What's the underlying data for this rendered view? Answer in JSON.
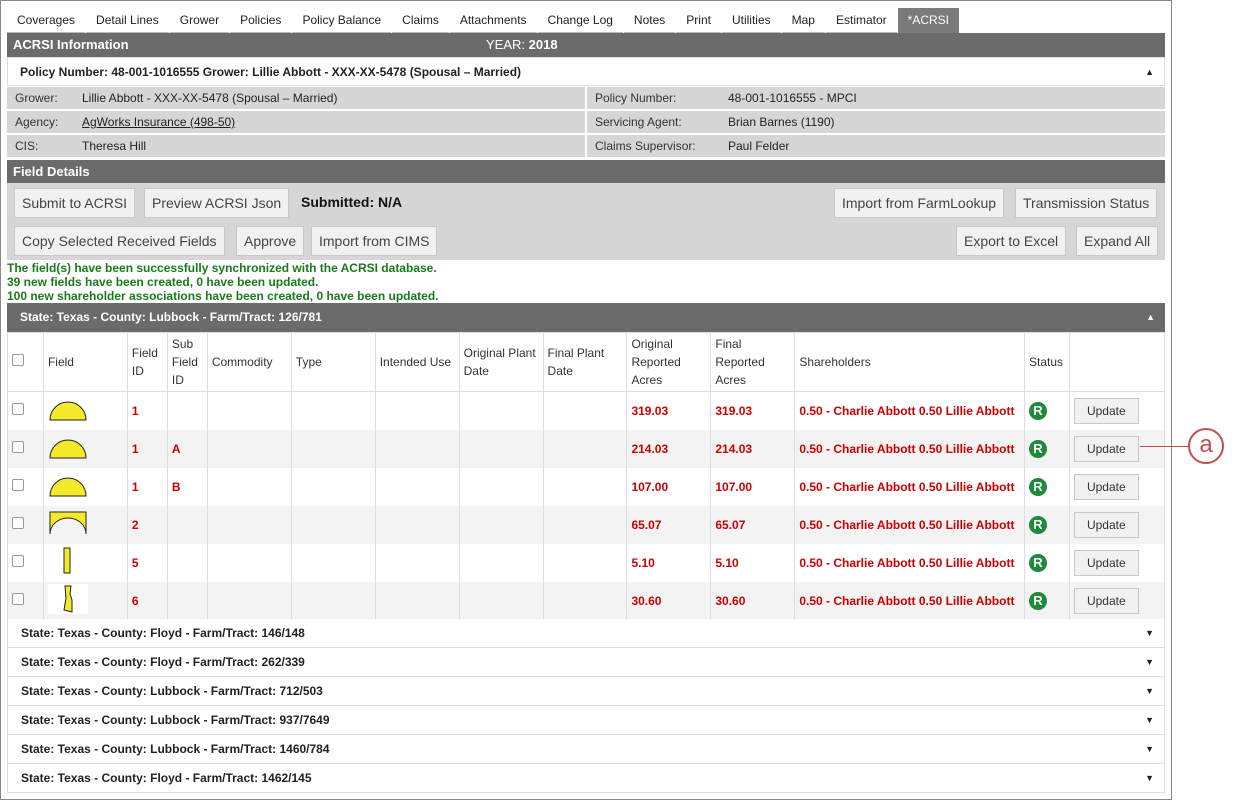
{
  "tabs": [
    "Coverages",
    "Detail Lines",
    "Grower",
    "Policies",
    "Policy Balance",
    "Claims",
    "Attachments",
    "Change Log",
    "Notes",
    "Print",
    "Utilities",
    "Map",
    "Estimator",
    "*ACRSI"
  ],
  "header": {
    "title": "ACRSI Information",
    "year_label": "YEAR:",
    "year": "2018"
  },
  "policy_line": "Policy Number: 48-001-1016555 Grower: Lillie Abbott - XXX-XX-5478 (Spousal – Married)",
  "info": {
    "grower_label": "Grower:",
    "grower": "Lillie Abbott - XXX-XX-5478 (Spousal – Married)",
    "policy_label": "Policy Number:",
    "policy": "48-001-1016555 - MPCI",
    "agency_label": "Agency:",
    "agency": "AgWorks Insurance (498-50)",
    "agent_label": "Servicing Agent:",
    "agent": "Brian Barnes (1190)",
    "cis_label": "CIS:",
    "cis": "Theresa Hill",
    "supervisor_label": "Claims Supervisor:",
    "supervisor": "Paul Felder"
  },
  "field_details": {
    "title": "Field Details",
    "submit": "Submit to ACRSI",
    "preview": "Preview ACRSI Json",
    "submitted": "Submitted: N/A",
    "import_farm": "Import from FarmLookup",
    "transmission": "Transmission Status",
    "copy": "Copy Selected Received Fields",
    "approve": "Approve",
    "import_cims": "Import from CIMS",
    "export": "Export to Excel",
    "expand": "Expand All"
  },
  "messages": [
    "The field(s) have been successfully synchronized with the ACRSI database.",
    "39 new fields have been created, 0 have been updated.",
    "100 new shareholder associations have been created, 0 have been updated."
  ],
  "open_group": "State: Texas - County: Lubbock - Farm/Tract: 126/781",
  "columns": {
    "field": "Field",
    "field_id": "Field ID",
    "sub_field_id": "Sub Field ID",
    "commodity": "Commodity",
    "type": "Type",
    "intended_use": "Intended Use",
    "orig_plant": "Original Plant Date",
    "final_plant": "Final Plant Date",
    "orig_acres": "Original Reported Acres",
    "final_acres": "Final Reported Acres",
    "shareholders": "Shareholders",
    "status": "Status"
  },
  "rows": [
    {
      "shape": "semicircle-icon",
      "field_id": "1",
      "sub": "",
      "orig": "319.03",
      "final": "319.03",
      "share": "0.50 - Charlie Abbott 0.50 Lillie Abbott",
      "status": "R",
      "action": "Update"
    },
    {
      "shape": "semicircle-icon",
      "field_id": "1",
      "sub": "A",
      "orig": "214.03",
      "final": "214.03",
      "share": "0.50 - Charlie Abbott 0.50 Lillie Abbott",
      "status": "R",
      "action": "Update"
    },
    {
      "shape": "semicircle-icon",
      "field_id": "1",
      "sub": "B",
      "orig": "107.00",
      "final": "107.00",
      "share": "0.50 - Charlie Abbott 0.50 Lillie Abbott",
      "status": "R",
      "action": "Update"
    },
    {
      "shape": "corner-field-icon",
      "field_id": "2",
      "sub": "",
      "orig": "65.07",
      "final": "65.07",
      "share": "0.50 - Charlie Abbott 0.50 Lillie Abbott",
      "status": "R",
      "action": "Update"
    },
    {
      "shape": "strip-field-icon",
      "field_id": "5",
      "sub": "",
      "orig": "5.10",
      "final": "5.10",
      "share": "0.50 - Charlie Abbott 0.50 Lillie Abbott",
      "status": "R",
      "action": "Update"
    },
    {
      "shape": "irregular-field-icon",
      "field_id": "6",
      "sub": "",
      "orig": "30.60",
      "final": "30.60",
      "share": "0.50 - Charlie Abbott 0.50 Lillie Abbott",
      "status": "R",
      "action": "Update"
    }
  ],
  "closed_groups": [
    "State: Texas - County: Floyd - Farm/Tract: 146/148",
    "State: Texas - County: Floyd - Farm/Tract: 262/339",
    "State: Texas - County: Lubbock - Farm/Tract: 712/503",
    "State: Texas - County: Lubbock - Farm/Tract: 937/7649",
    "State: Texas - County: Lubbock - Farm/Tract: 1460/784",
    "State: Texas - County: Floyd - Farm/Tract: 1462/145"
  ],
  "callout": "a",
  "colors": {
    "header_bar": "#6b6b6b",
    "accent_red": "#cc0000",
    "status_green": "#1e8a3c",
    "message_green": "#1a7a1a",
    "field_fill": "#f4ea2a"
  }
}
